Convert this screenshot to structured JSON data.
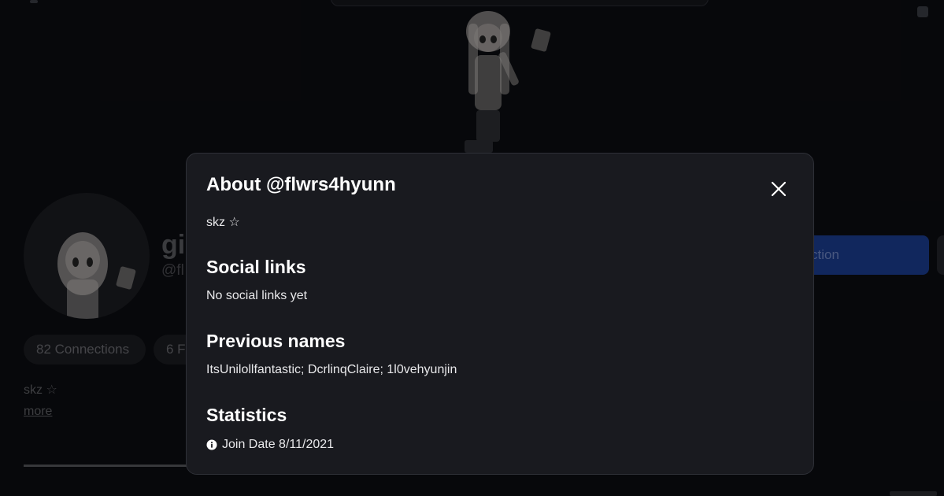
{
  "profile_background": {
    "display_name_partial": "gi",
    "handle_partial": "@fl",
    "action_button_partial": "ction",
    "connections_label": "82 Connections",
    "followers_partial": "6 F",
    "bio": "skz ☆",
    "more_link": "more"
  },
  "about_modal": {
    "title": "About @flwrs4hyunn",
    "bio": "skz ☆",
    "social_links": {
      "heading": "Social links",
      "text": "No social links yet"
    },
    "previous_names": {
      "heading": "Previous names",
      "text": "ItsUnilollfantastic; DcrlinqClaire; 1l0vehyunjin"
    },
    "statistics": {
      "heading": "Statistics",
      "join_date": "Join Date 8/11/2021"
    },
    "close_icon": "close-icon",
    "info_icon": "info-icon"
  },
  "colors": {
    "page_background": "#0c0d11",
    "modal_background": "#191a1f",
    "primary_button": "#1b3d8f"
  }
}
